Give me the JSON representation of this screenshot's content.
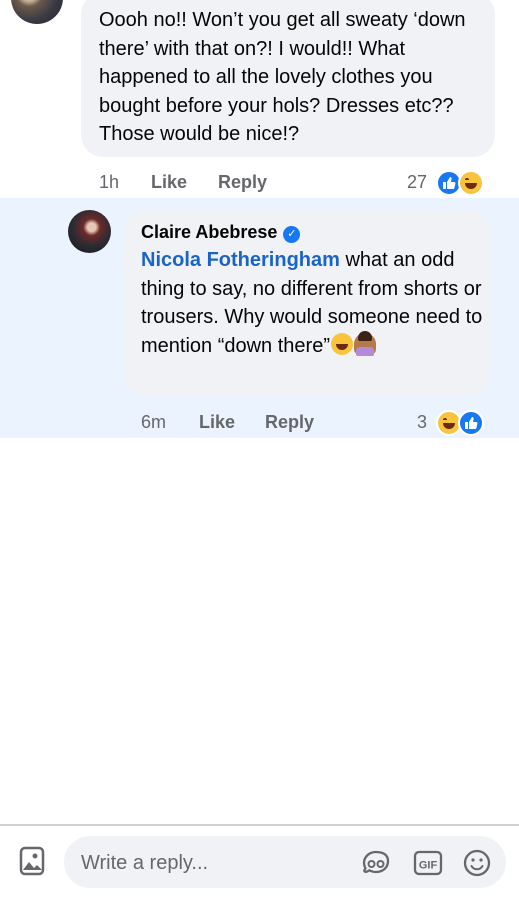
{
  "comment_top": {
    "text": "Oooh no!! Won’t you get all sweaty ‘down there’ with that on?! I would!! What happened to all the lovely clothes you bought before your hols? Dresses etc?? Those would be nice!?",
    "time": "1h",
    "like_label": "Like",
    "reply_label": "Reply",
    "reaction_count": "27",
    "reactions": [
      "like-icon",
      "haha-icon"
    ]
  },
  "reply": {
    "author": "Claire Abebrese",
    "verified": true,
    "mention": "Nicola Fotheringham",
    "text": " what an odd thing to say, no different from shorts or trousers. Why would someone need to mention “down there”",
    "emojis": [
      "laughing-tears-emoji",
      "facepalm-emoji"
    ],
    "time": "6m",
    "like_label": "Like",
    "reply_label": "Reply",
    "reaction_count": "3",
    "reactions": [
      "haha-icon",
      "like-icon"
    ],
    "highlight_color": "#ebf4fe"
  },
  "composer": {
    "placeholder": "Write a reply...",
    "icons": [
      "photo-icon",
      "avatar-sticker-icon",
      "gif-icon",
      "emoji-icon"
    ]
  },
  "colors": {
    "bubble": "#f0f2f5",
    "mention": "#1a64c8",
    "meta": "#65676b",
    "like_blue": "#1877f2"
  }
}
